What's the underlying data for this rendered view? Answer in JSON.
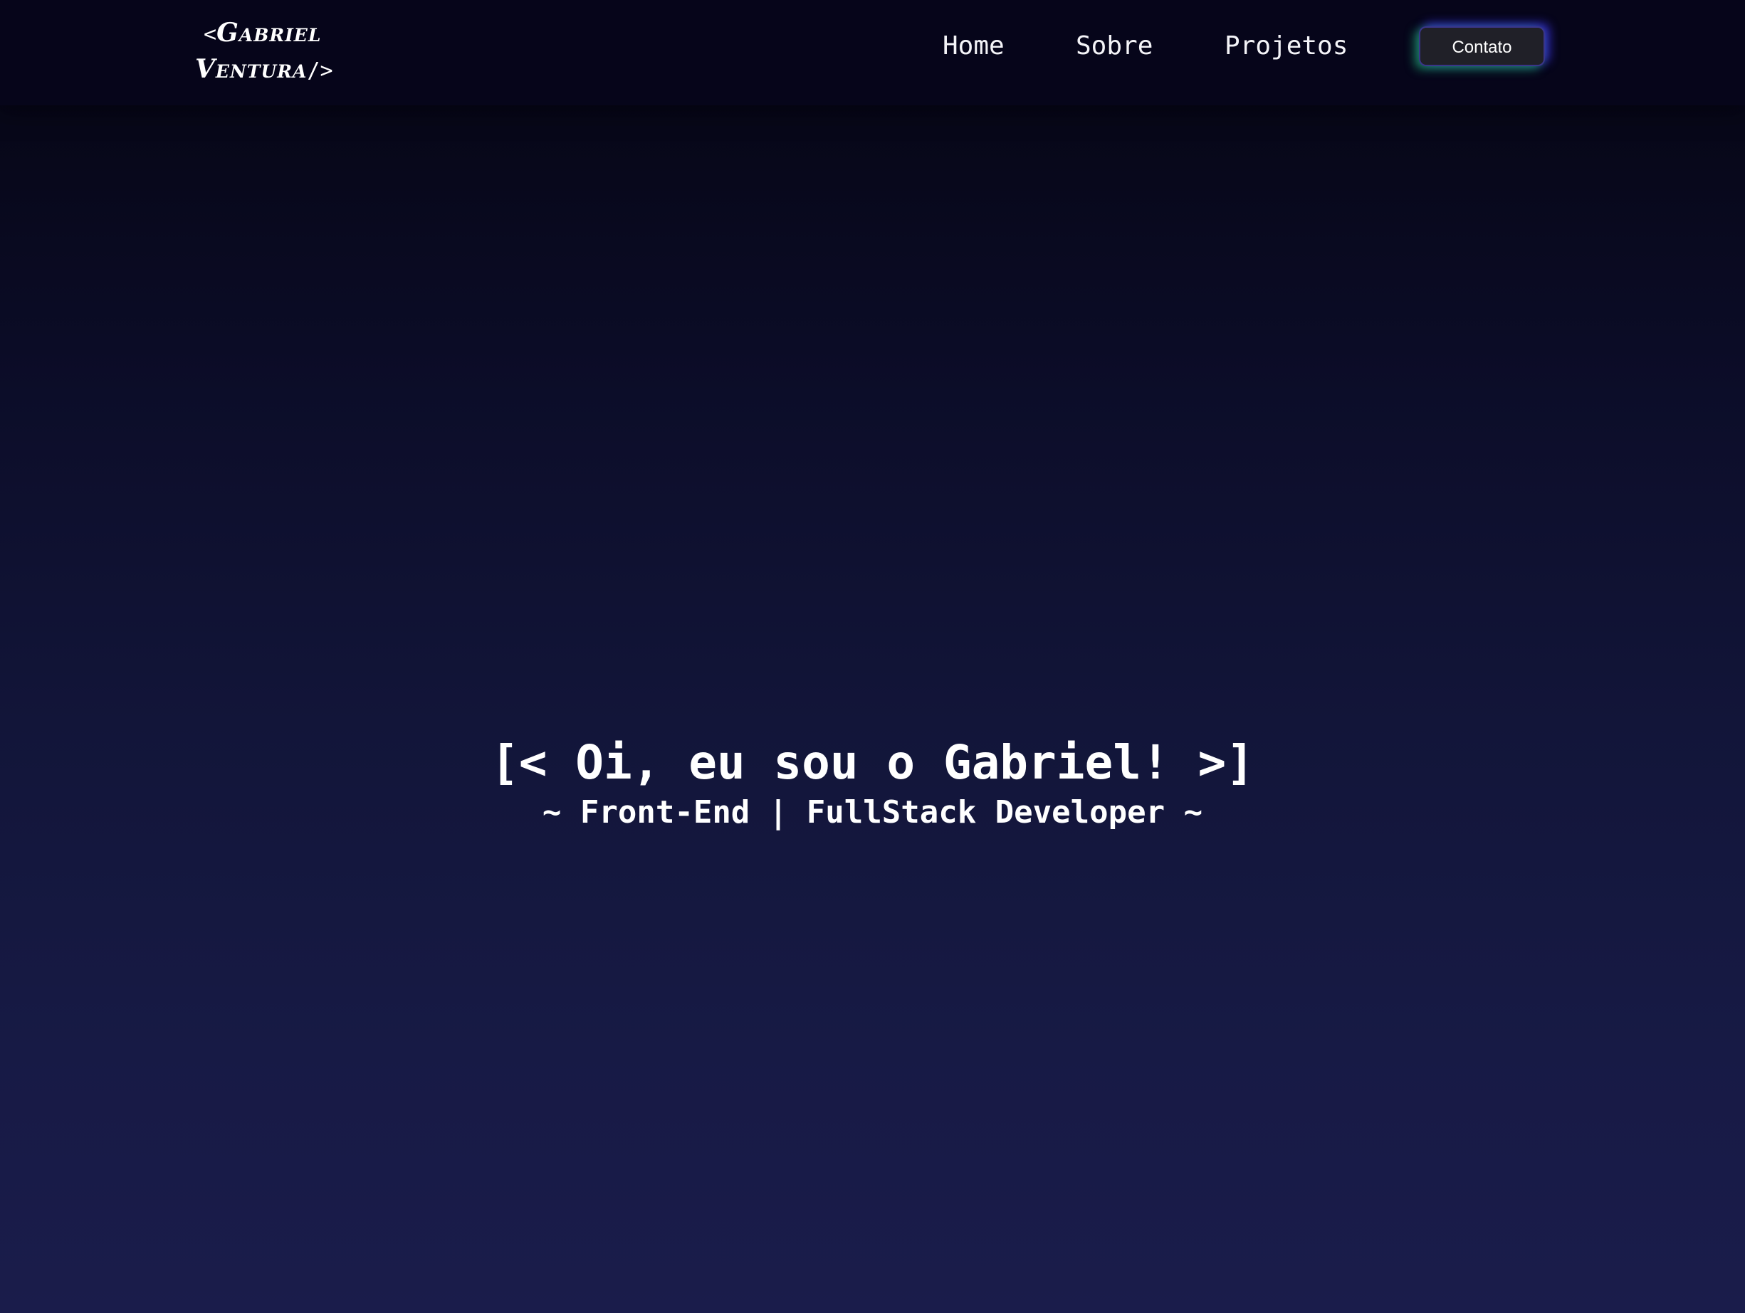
{
  "header": {
    "logo": {
      "open_bracket": "<",
      "first_name": "Gabriel",
      "last_name": "Ventura",
      "close_tag": "/>"
    },
    "nav": [
      {
        "label": "Home"
      },
      {
        "label": "Sobre"
      },
      {
        "label": "Projetos"
      }
    ],
    "contact_label": "Contato"
  },
  "hero": {
    "title": "[< Oi, eu sou o Gabriel! >]",
    "subtitle": "~ Front-End | FullStack Developer ~"
  },
  "colors": {
    "background_top": "#05040f",
    "background_bottom": "#1a1c4b",
    "header_bg": "#06051a",
    "button_bg": "#202028",
    "glow_green": "#28dc8c",
    "glow_blue": "#463cff",
    "text": "#ffffff"
  }
}
